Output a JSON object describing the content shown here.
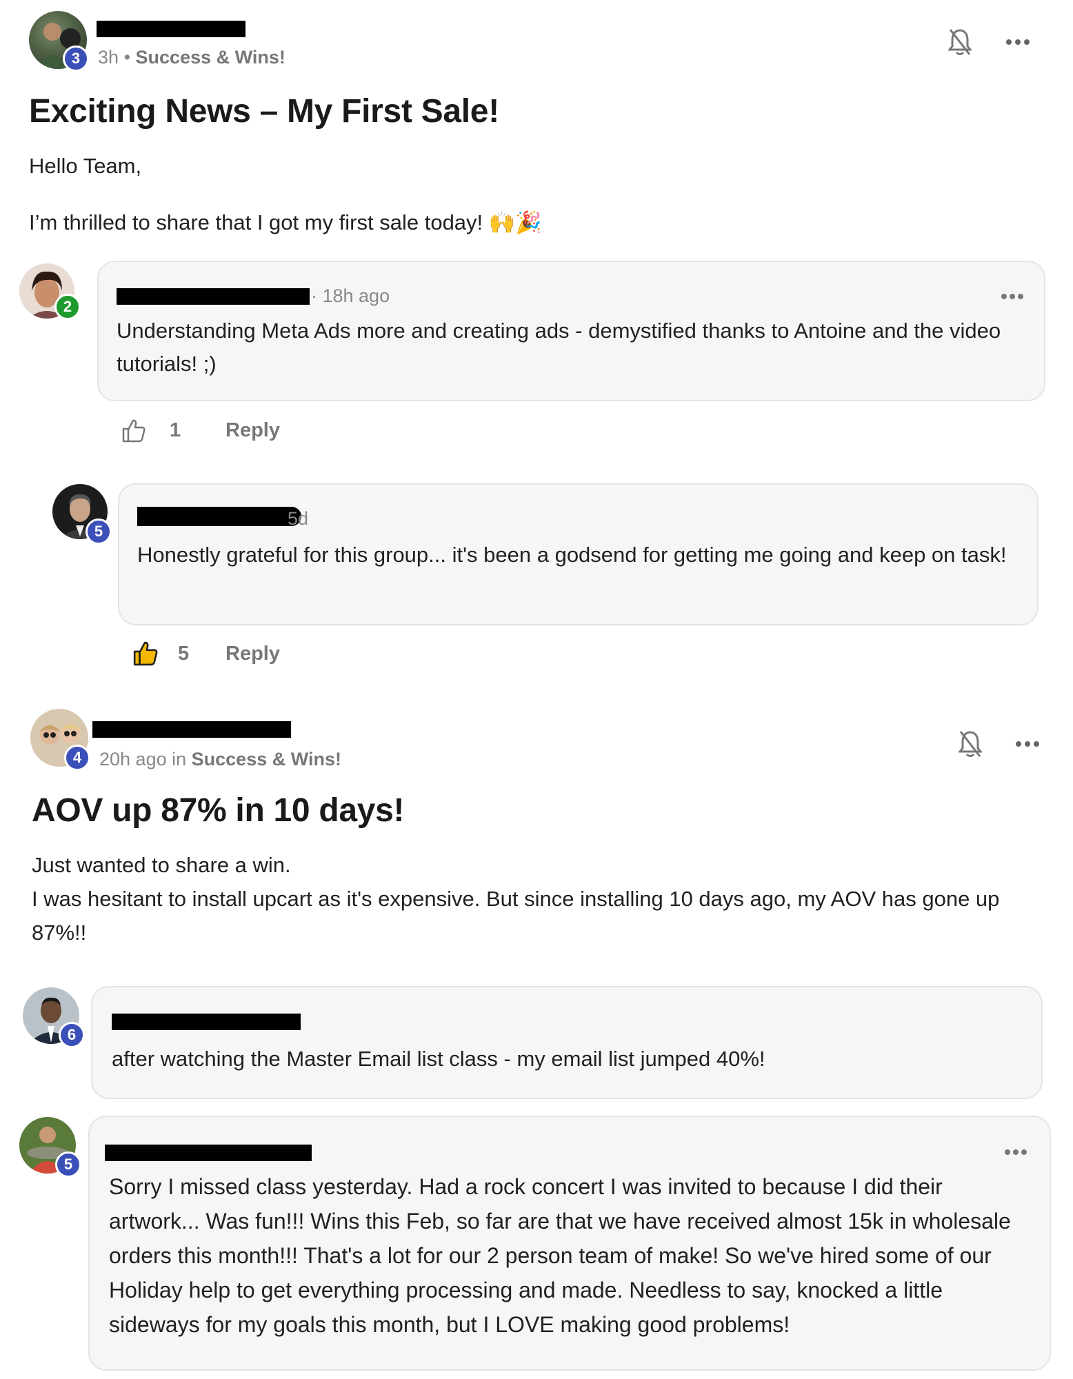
{
  "post1": {
    "badge": "3",
    "time": "3h",
    "separator": "•",
    "category": "Success & Wins!",
    "title": "Exciting News – My First Sale!",
    "greeting": "Hello Team,",
    "body": "I’m thrilled to share that I got my first sale today! 🙌🎉"
  },
  "comment1": {
    "badge": "2",
    "time": "· 18h ago",
    "text": "Understanding Meta Ads more and creating ads - demystified thanks to Antoine and the video tutorials! ;)",
    "likes": "1",
    "reply_label": "Reply"
  },
  "comment2": {
    "badge": "5",
    "time": "5d",
    "text": "Honestly grateful for this group... it's been a godsend for getting me going and keep on task!",
    "likes": "5",
    "reply_label": "Reply"
  },
  "post2": {
    "badge": "4",
    "time": "20h ago in",
    "category": "Success & Wins!",
    "title": "AOV up 87% in 10 days!",
    "line1": "Just wanted to share a win.",
    "line2": "I was hesitant to install upcart as it's expensive. But since installing 10 days ago, my AOV has gone up 87%!!"
  },
  "comment3": {
    "badge": "6",
    "text": "after watching the Master Email list class - my email list jumped 40%!"
  },
  "comment4": {
    "badge": "5",
    "text": "Sorry I missed class yesterday. Had a rock concert I was invited to because I did their artwork... Was fun!!! Wins this Feb, so far are that we have received almost 15k in wholesale orders this month!!! That's a lot for our 2 person team of make! So we've hired some of our Holiday help to get everything processing and made. Needless to say, knocked a little sideways for my goals this month, but I LOVE making good problems!"
  },
  "icons": {
    "bell_off": "bell-off-icon",
    "more": "more-horizontal-icon",
    "thumbs_up": "thumbs-up-icon"
  },
  "colors": {
    "badge_blue": "#3b4fb8",
    "badge_green": "#1c9a2e",
    "card_bg": "#f6f6f6",
    "thumb_active": "#f5b800"
  }
}
